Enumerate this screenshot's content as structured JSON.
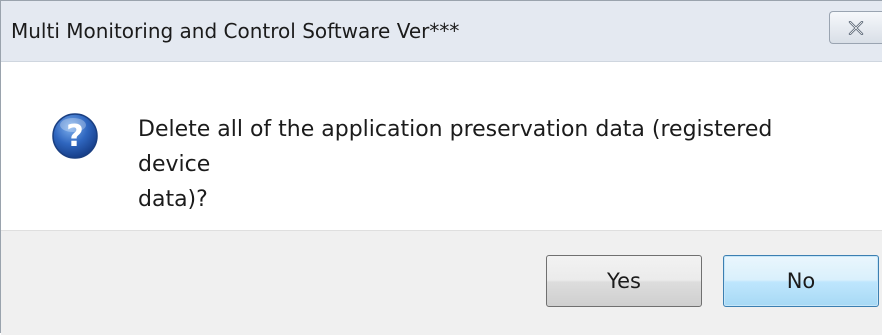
{
  "dialog": {
    "title": "Multi Monitoring and Control Software Ver",
    "title_suffix": "***",
    "close_icon": "close-x-icon",
    "question_icon": "question-mark-icon",
    "message_line1": "Delete all of the application preservation data (registered device",
    "message_line2": "data)?",
    "buttons": {
      "yes_label": "Yes",
      "no_label": "No"
    }
  },
  "colors": {
    "titlebar": "#e4e9f1",
    "button_area": "#f0f0f0",
    "default_button_border": "#3c7fb1",
    "icon_blue": "#2a5fb0"
  }
}
